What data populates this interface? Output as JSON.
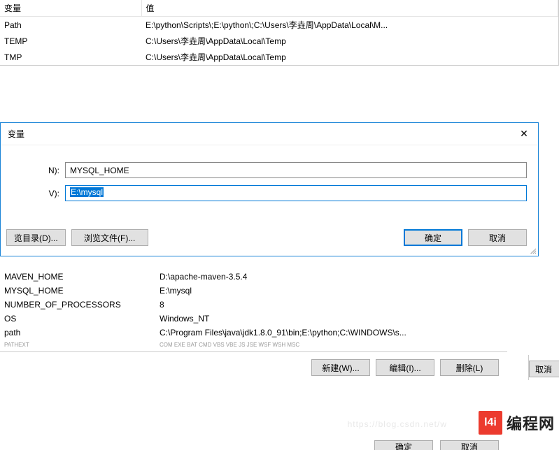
{
  "user_table": {
    "header_var": "变量",
    "header_val": "值",
    "rows": [
      {
        "var": "Path",
        "val": "E:\\python\\Scripts\\;E:\\python\\;C:\\Users\\李垚周\\AppData\\Local\\M..."
      },
      {
        "var": "TEMP",
        "val": "C:\\Users\\李垚周\\AppData\\Local\\Temp"
      },
      {
        "var": "TMP",
        "val": "C:\\Users\\李垚周\\AppData\\Local\\Temp"
      }
    ]
  },
  "dialog": {
    "title_fragment": "变量",
    "label_name_fragment": "N):",
    "label_value_fragment": "V):",
    "input_name": "MYSQL_HOME",
    "input_value": "E:\\mysql",
    "browse_dir_fragment": "览目录(D)...",
    "browse_file": "浏览文件(F)...",
    "ok": "确定",
    "cancel": "取消"
  },
  "sys_table": {
    "rows": [
      {
        "var": "MAVEN_HOME",
        "val": "D:\\apache-maven-3.5.4"
      },
      {
        "var": "MYSQL_HOME",
        "val": "E:\\mysql"
      },
      {
        "var": "NUMBER_OF_PROCESSORS",
        "val": "8"
      },
      {
        "var": "OS",
        "val": "Windows_NT"
      },
      {
        "var": "path",
        "val": "C:\\Program Files\\java\\jdk1.8.0_91\\bin;E:\\python;C:\\WINDOWS\\s..."
      },
      {
        "var": "PATHEXT",
        "val": ".COM;.EXE;.BAT;.CMD;.VBS;.VBE;.JS;.JSE;.WSF;.WSH;.MSC"
      }
    ],
    "new_btn": "新建(W)...",
    "edit_btn": "编辑(I)...",
    "del_btn": "删除(L)"
  },
  "outer": {
    "cancel_fragment": "取消",
    "ok": "确定",
    "cancel": "取消"
  },
  "watermark": {
    "logo_text": "l4i",
    "brand": "编程网",
    "faint_url": "https://blog.csdn.net/w"
  }
}
